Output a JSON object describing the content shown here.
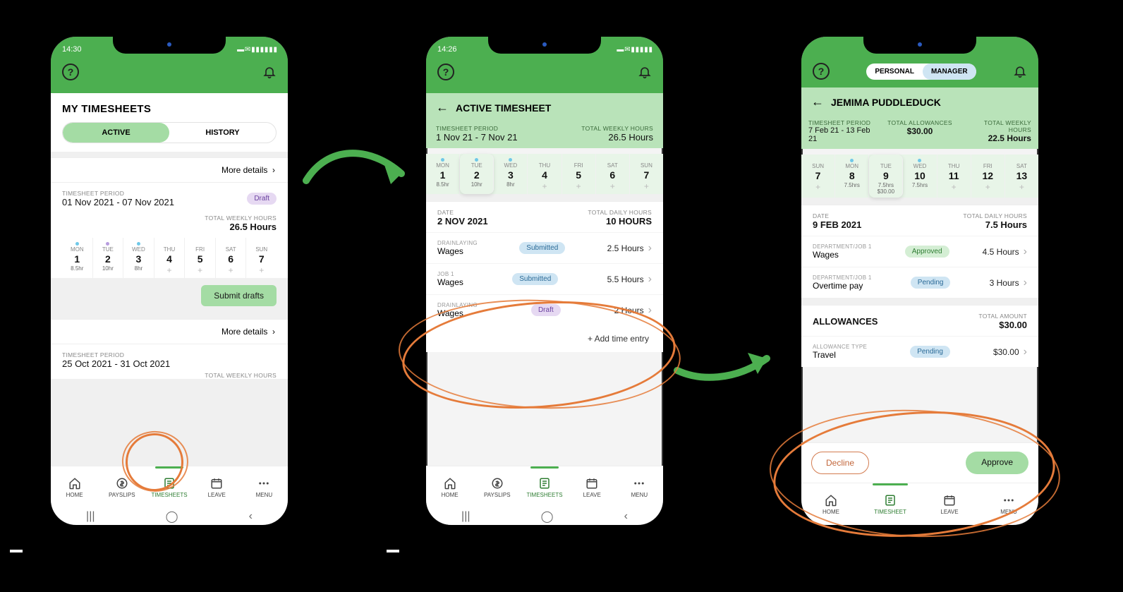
{
  "phone1": {
    "status_time": "14:30",
    "title": "MY TIMESHEETS",
    "tabs": {
      "active": "ACTIVE",
      "history": "HISTORY"
    },
    "more": "More details",
    "period_label": "TIMESHEET PERIOD",
    "period1": "01 Nov 2021 - 07 Nov 2021",
    "draft": "Draft",
    "hours_label": "TOTAL WEEKLY HOURS",
    "hours1": "26.5 Hours",
    "days": [
      {
        "dow": "MON",
        "num": "1",
        "hrs": "8.5hr",
        "dot": "dot-blue"
      },
      {
        "dow": "TUE",
        "num": "2",
        "hrs": "10hr",
        "dot": "dot-purple"
      },
      {
        "dow": "WED",
        "num": "3",
        "hrs": "8hr",
        "dot": "dot-blue"
      },
      {
        "dow": "THU",
        "num": "4",
        "hrs": "+",
        "dot": "dot-none"
      },
      {
        "dow": "FRI",
        "num": "5",
        "hrs": "+",
        "dot": "dot-none"
      },
      {
        "dow": "SAT",
        "num": "6",
        "hrs": "+",
        "dot": "dot-none"
      },
      {
        "dow": "SUN",
        "num": "7",
        "hrs": "+",
        "dot": "dot-none"
      }
    ],
    "submit": "Submit drafts",
    "period2": "25 Oct 2021 - 31 Oct 2021",
    "tabbar": [
      "HOME",
      "PAYSLIPS",
      "TIMESHEETS",
      "LEAVE",
      "MENU"
    ]
  },
  "phone2": {
    "status_time": "14:26",
    "title": "ACTIVE TIMESHEET",
    "period_label": "TIMESHEET PERIOD",
    "period": "1 Nov 21 - 7 Nov 21",
    "hours_label": "TOTAL WEEKLY HOURS",
    "hours": "26.5 Hours",
    "days": [
      {
        "dow": "MON",
        "num": "1",
        "hrs": "8.5hr"
      },
      {
        "dow": "TUE",
        "num": "2",
        "hrs": "10hr"
      },
      {
        "dow": "WED",
        "num": "3",
        "hrs": "8hr"
      },
      {
        "dow": "THU",
        "num": "4",
        "hrs": "+"
      },
      {
        "dow": "FRI",
        "num": "5",
        "hrs": "+"
      },
      {
        "dow": "SAT",
        "num": "6",
        "hrs": "+"
      },
      {
        "dow": "SUN",
        "num": "7",
        "hrs": "+"
      }
    ],
    "date_label": "DATE",
    "date": "2 NOV 2021",
    "daily_label": "TOTAL DAILY HOURS",
    "daily": "10 HOURS",
    "entries": [
      {
        "cat": "DRAINLAYING",
        "pay": "Wages",
        "status": "Submitted",
        "status_cls": "badge-submitted",
        "hrs": "2.5 Hours"
      },
      {
        "cat": "JOB 1",
        "pay": "Wages",
        "status": "Submitted",
        "status_cls": "badge-submitted",
        "hrs": "5.5 Hours"
      },
      {
        "cat": "DRAINLAYING",
        "pay": "Wages",
        "status": "Draft",
        "status_cls": "badge-draft",
        "hrs": "2 Hours"
      }
    ],
    "add": "+  Add time entry",
    "tabbar": [
      "HOME",
      "PAYSLIPS",
      "TIMESHEETS",
      "LEAVE",
      "MENU"
    ]
  },
  "phone3": {
    "toggle": {
      "personal": "PERSONAL",
      "manager": "MANAGER"
    },
    "name": "JEMIMA PUDDLEDUCK",
    "period_label": "TIMESHEET PERIOD",
    "period": "7 Feb 21 - 13 Feb 21",
    "allow_label": "TOTAL ALLOWANCES",
    "allow": "$30.00",
    "hours_label": "TOTAL WEEKLY HOURS",
    "hours": "22.5 Hours",
    "days": [
      {
        "dow": "SUN",
        "num": "7",
        "hrs": "+"
      },
      {
        "dow": "MON",
        "num": "8",
        "hrs": "7.5hrs"
      },
      {
        "dow": "TUE",
        "num": "9",
        "sub": "7.5hrs",
        "sub2": "$30.00"
      },
      {
        "dow": "WED",
        "num": "10",
        "hrs": "7.5hrs"
      },
      {
        "dow": "THU",
        "num": "11",
        "hrs": "+"
      },
      {
        "dow": "FRI",
        "num": "12",
        "hrs": "+"
      },
      {
        "dow": "SAT",
        "num": "13",
        "hrs": "+"
      }
    ],
    "date_label": "DATE",
    "date": "9 FEB 2021",
    "daily_label": "TOTAL DAILY HOURS",
    "daily": "7.5 Hours",
    "entries": [
      {
        "cat": "DEPARTMENT/JOB 1",
        "pay": "Wages",
        "status": "Approved",
        "status_cls": "badge-approved",
        "hrs": "4.5 Hours"
      },
      {
        "cat": "DEPARTMENT/JOB 1",
        "pay": "Overtime pay",
        "status": "Pending",
        "status_cls": "badge-pending",
        "hrs": "3 Hours"
      }
    ],
    "allowances_title": "ALLOWANCES",
    "allowances_amount_label": "TOTAL AMOUNT",
    "allowances_amount": "$30.00",
    "allow_entry": {
      "cat": "ALLOWANCE TYPE",
      "pay": "Travel",
      "status": "Pending",
      "amt": "$30.00"
    },
    "decline": "Decline",
    "approve": "Approve",
    "tabbar": [
      "HOME",
      "TIMESHEET",
      "LEAVE",
      "MENU"
    ]
  }
}
